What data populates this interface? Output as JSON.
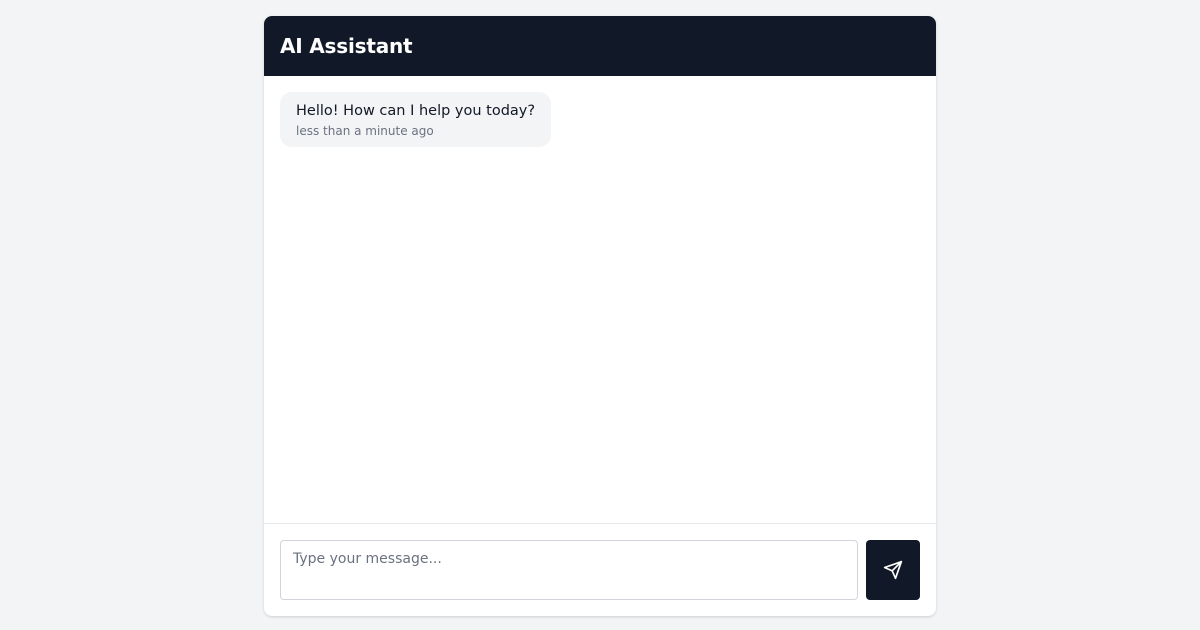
{
  "header": {
    "title": "AI Assistant"
  },
  "messages": [
    {
      "role": "assistant",
      "text": "Hello! How can I help you today?",
      "time": "less than a minute ago"
    }
  ],
  "composer": {
    "placeholder": "Type your message...",
    "value": "",
    "send_icon": "send-icon"
  },
  "colors": {
    "header_bg": "#111827",
    "bubble_bg": "#f3f4f6",
    "page_bg": "#f3f4f6",
    "send_button_bg": "#111827"
  }
}
